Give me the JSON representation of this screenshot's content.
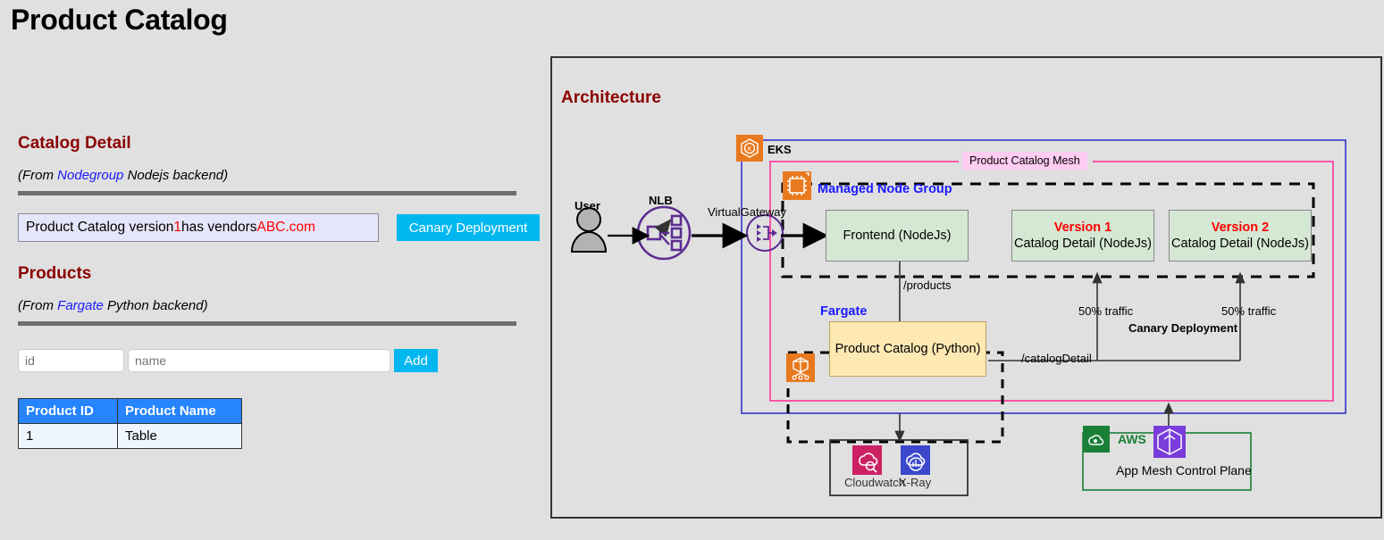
{
  "page": {
    "title": "Product Catalog"
  },
  "catalog": {
    "heading": "Catalog Detail",
    "subtitle_pre": "(From ",
    "subtitle_hl": "Nodegroup",
    "subtitle_post": " Nodejs backend)",
    "result_pre": "Product Catalog version ",
    "result_version": "1",
    "result_mid": " has vendors ",
    "result_vendor": "ABC.com",
    "canary_button": "Canary Deployment"
  },
  "products": {
    "heading": "Products",
    "subtitle_pre": "(From ",
    "subtitle_hl": "Fargate",
    "subtitle_post": " Python backend)",
    "id_placeholder": "id",
    "id_value": "",
    "name_placeholder": "name",
    "name_value": "",
    "add_button": "Add",
    "columns": [
      "Product ID",
      "Product Name"
    ],
    "rows": [
      {
        "id": "1",
        "name": "Table"
      }
    ]
  },
  "architecture": {
    "title": "Architecture",
    "user_label": "User",
    "nlb_label": "NLB",
    "virtual_gateway_label": "VirtualGateway",
    "eks_label": "EKS",
    "mesh_label": "Product Catalog Mesh",
    "managed_node_group_label": "Managed Node Group",
    "fargate_label": "Fargate",
    "frontend_box": "Frontend (NodeJs)",
    "version1_title": "Version 1",
    "version1_sub": "Catalog Detail (NodeJs)",
    "version2_title": "Version 2",
    "version2_sub": "Catalog Detail (NodeJs)",
    "product_catalog_box": "Product Catalog (Python)",
    "edge_products": "/products",
    "edge_catalog_detail": "/catalogDetail",
    "traffic_left": "50% traffic",
    "traffic_right": "50% traffic",
    "canary_deployment_label": "Canary Deployment",
    "cloudwatch_label": "Cloudwatch",
    "xray_label": "X-Ray",
    "aws_label": "AWS",
    "app_mesh_label": "App Mesh Control Plane"
  },
  "colors": {
    "heading_red": "#8b0000",
    "accent_blue": "#00b7f0",
    "table_header": "#2684ff",
    "link_blue": "#1a1aff",
    "value_red": "#ff0000",
    "aws_orange": "#e8791e",
    "mesh_pink": "#ff3399",
    "eks_blue_border": "#3333cc",
    "green_box": "#d5e8d4",
    "yellow_box": "#ffe9b3",
    "purple": "#5c2d91",
    "aws_green": "#1a7f37"
  }
}
